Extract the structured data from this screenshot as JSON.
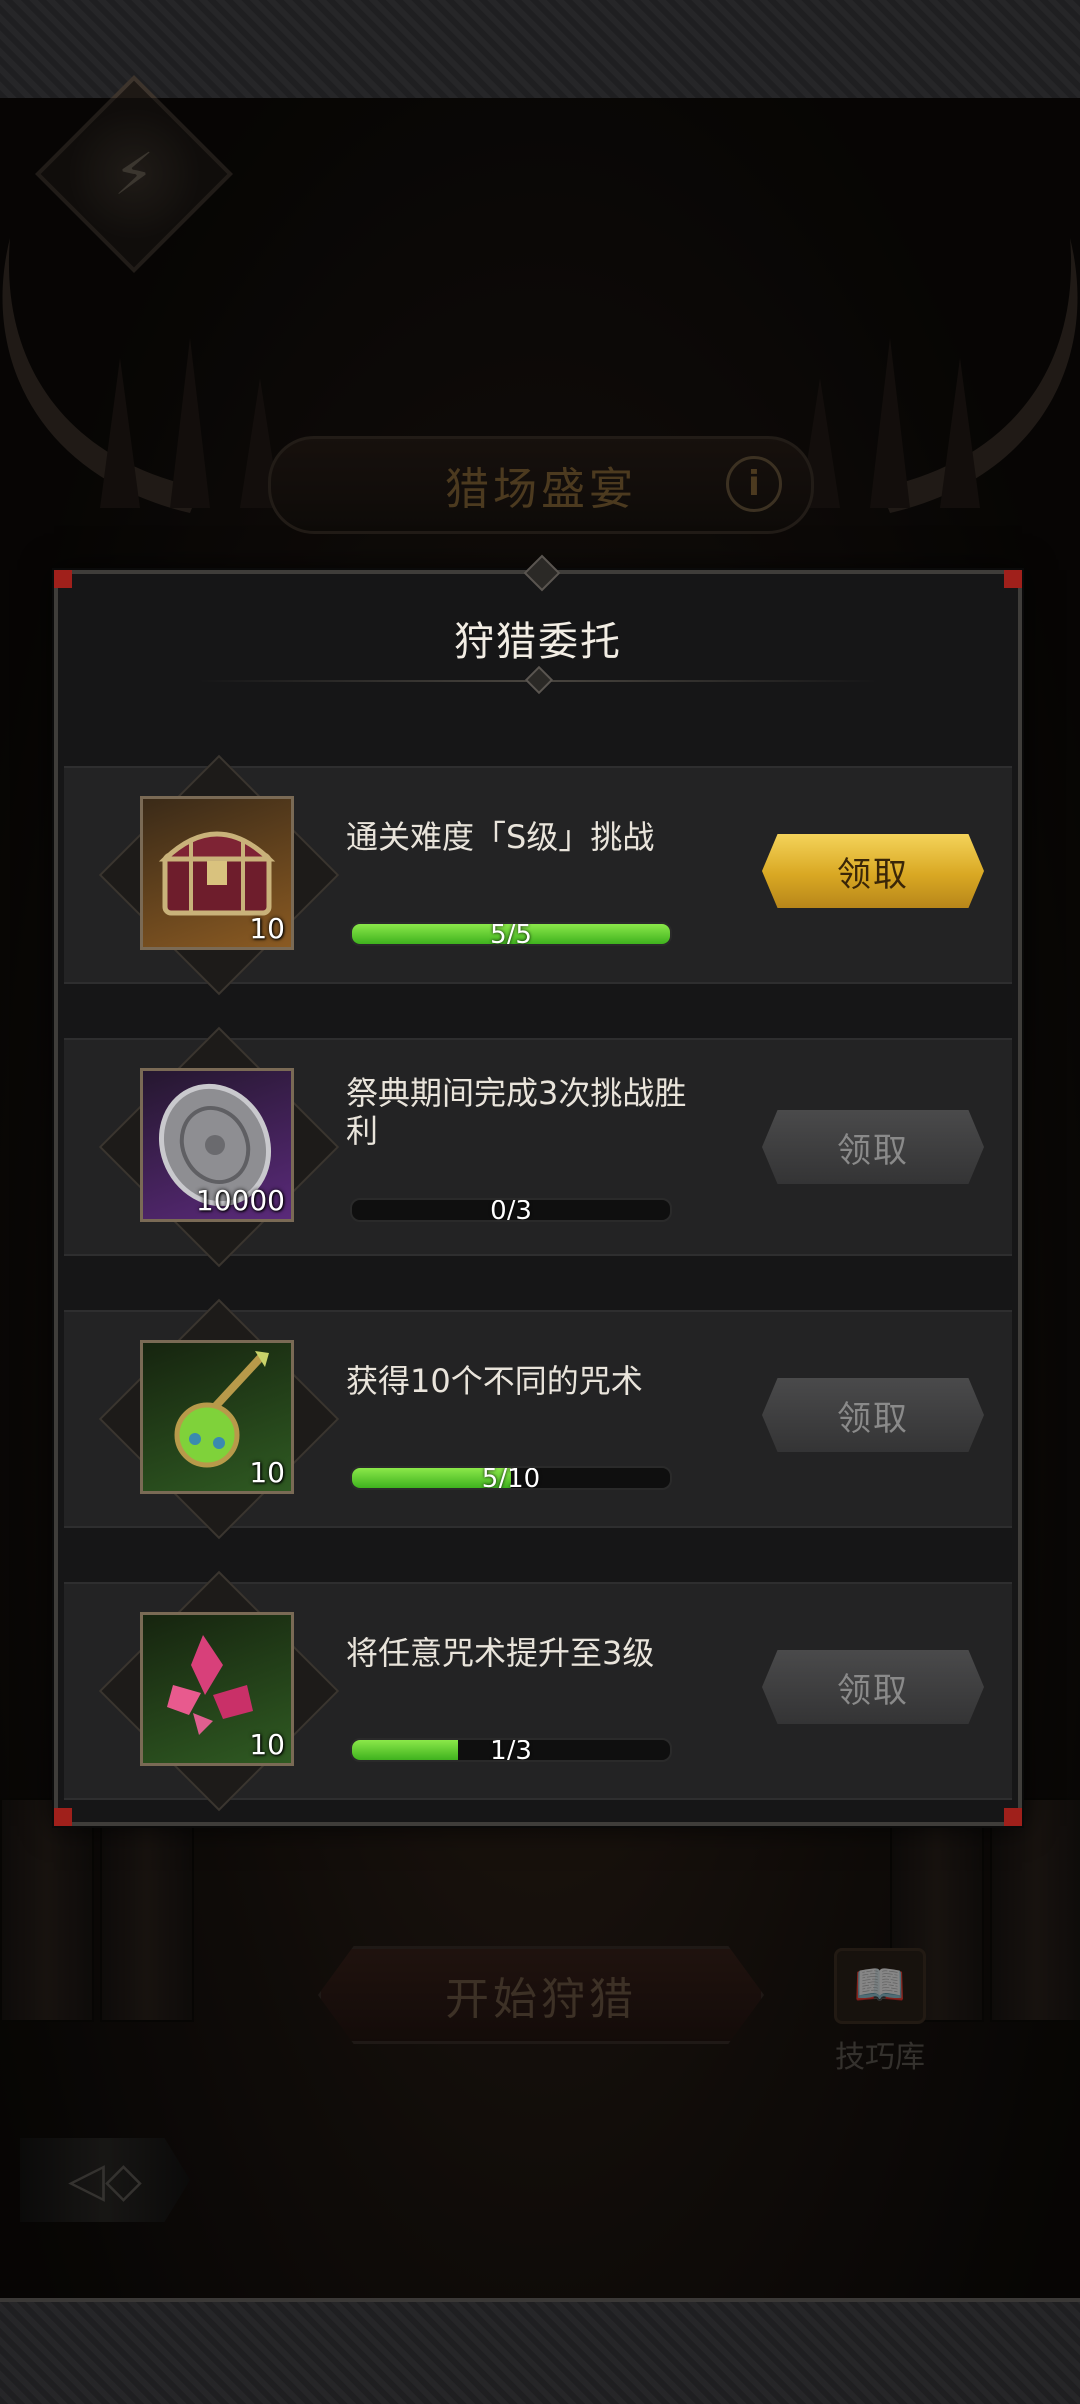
{
  "background": {
    "banner_title": "猎场盛宴",
    "start_button_label": "开始狩猎",
    "tips_label": "技巧库"
  },
  "modal": {
    "title": "狩猎委托",
    "tasks": [
      {
        "description": "通关难度「S级」挑战",
        "reward_icon": "treasure-chest",
        "reward_qty": "10",
        "progress_text": "5/5",
        "progress": 1.0,
        "claim_label": "领取",
        "claim_enabled": true,
        "rarity_color": "#8a5a22"
      },
      {
        "description": "祭典期间完成3次挑战胜利",
        "reward_icon": "silver-coin",
        "reward_qty": "10000",
        "progress_text": "0/3",
        "progress": 0.0,
        "claim_label": "领取",
        "claim_enabled": false,
        "rarity_color": "#5a2a7a"
      },
      {
        "description": "获得10个不同的咒术",
        "reward_icon": "green-potion",
        "reward_qty": "10",
        "progress_text": "5/10",
        "progress": 0.5,
        "claim_label": "领取",
        "claim_enabled": false,
        "rarity_color": "#2f5a22"
      },
      {
        "description": "将任意咒术提升至3级",
        "reward_icon": "pink-crystals",
        "reward_qty": "10",
        "progress_text": "1/3",
        "progress": 0.333,
        "claim_label": "领取",
        "claim_enabled": false,
        "rarity_color": "#2f5a22"
      }
    ]
  }
}
